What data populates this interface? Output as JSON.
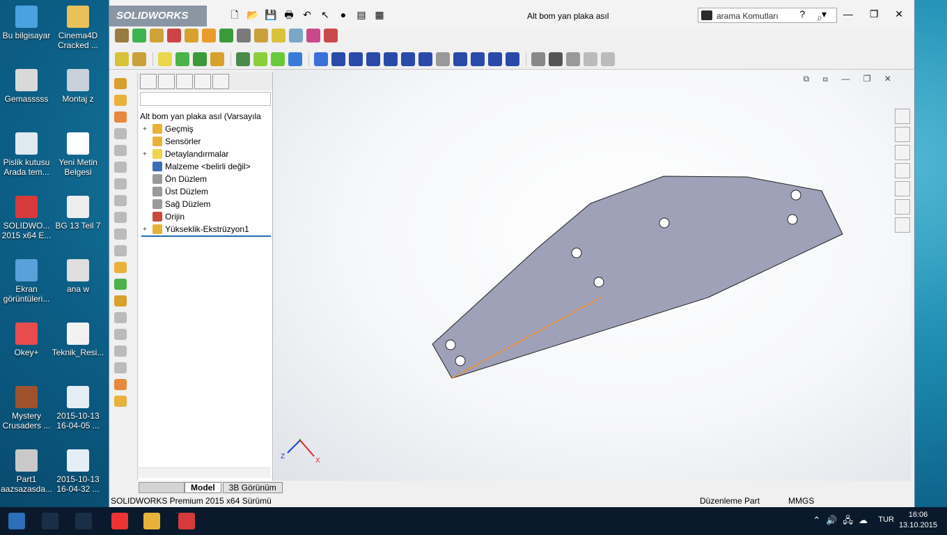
{
  "desktop": {
    "icons": [
      {
        "label": "Bu bilgisayar",
        "color": "#4aa3df"
      },
      {
        "label": "Cinema4D\nCracked ...",
        "color": "#e8c15a"
      },
      {
        "label": "Gemasssss",
        "color": "#d9d9d9"
      },
      {
        "label": "Montaj z",
        "color": "#c7d1db"
      },
      {
        "label": "Pislik kutusu\nArada tem...",
        "color": "#e0e8f0"
      },
      {
        "label": "Yeni Metin\nBelgesi",
        "color": "#ffffff"
      },
      {
        "label": "SOLIDWO...\n2015 x64 E...",
        "color": "#d63a3a"
      },
      {
        "label": "BG 13 Teil 7",
        "color": "#eeeeee"
      },
      {
        "label": "Ekran\ngörüntüleri...",
        "color": "#5aa0d9"
      },
      {
        "label": "ana w",
        "color": "#dedede"
      },
      {
        "label": "Okey+",
        "color": "#e84c4c"
      },
      {
        "label": "Teknik_Resi...",
        "color": "#f2f2f2"
      },
      {
        "label": "Mystery\nCrusaders ...",
        "color": "#a0522d"
      },
      {
        "label": "2015-10-13\n16-04-05 ...",
        "color": "#e6eef5"
      },
      {
        "label": "Part1\naazsazasda...",
        "color": "#c9c9c9"
      },
      {
        "label": "2015-10-13\n16-04-32 ...",
        "color": "#e6eef5"
      }
    ]
  },
  "app": {
    "logo": "SOLIDWORKS",
    "title": "Alt bom yan plaka asıl",
    "search_placeholder": "arama Komutları",
    "window_controls": "? ▾ — ❐ ✕"
  },
  "feature_tree": {
    "root": "Alt bom yan plaka asıl  (Varsayıla",
    "items": [
      {
        "label": "Geçmiş",
        "expand": "+",
        "icon_color": "#e8b23a"
      },
      {
        "label": "Sensörler",
        "expand": "",
        "icon_color": "#e8b23a"
      },
      {
        "label": "Detaylandırmalar",
        "expand": "+",
        "icon_color": "#f0d44a"
      },
      {
        "label": "Malzeme <belirli değil>",
        "expand": "",
        "icon_color": "#3a6fb5"
      },
      {
        "label": "Ön Düzlem",
        "expand": "",
        "icon_color": "#9a9a9a"
      },
      {
        "label": "Üst Düzlem",
        "expand": "",
        "icon_color": "#9a9a9a"
      },
      {
        "label": "Sağ Düzlem",
        "expand": "",
        "icon_color": "#9a9a9a"
      },
      {
        "label": "Orijin",
        "expand": "",
        "icon_color": "#c94a3a"
      },
      {
        "label": "Yükseklik-Ekstrüzyon1",
        "expand": "+",
        "icon_color": "#e8b23a"
      }
    ]
  },
  "bottom_tabs": {
    "model": "Model",
    "view3d": "3B Görünüm"
  },
  "status": {
    "version": "SOLIDWORKS Premium 2015 x64 Sürümü",
    "mode": "Düzenleme Part",
    "units": "MMGS"
  },
  "viewport": {
    "part_color": "#9ea1b8",
    "edge_highlight": "#ff8c1a",
    "axis_x": "X",
    "axis_z": "Z"
  },
  "taskbar": {
    "lang": "TUR",
    "time": "16:06",
    "date": "13.10.2015"
  }
}
